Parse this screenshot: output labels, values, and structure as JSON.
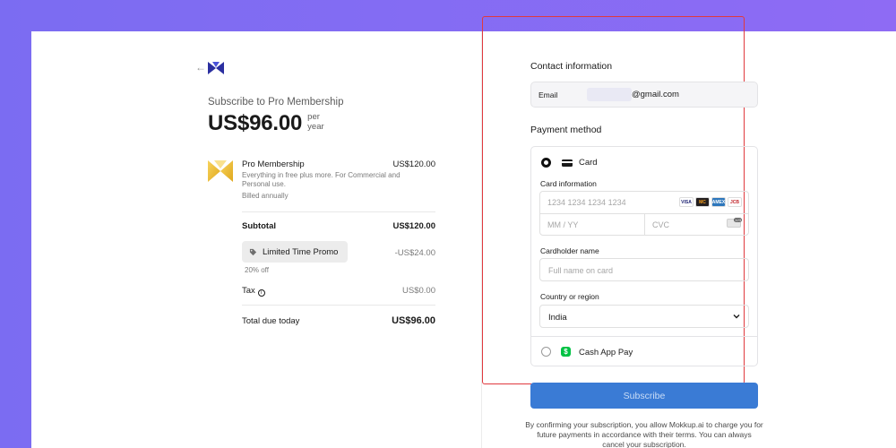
{
  "summary": {
    "back_icon": "arrow-left-icon",
    "logo_icon": "mokkup-logo-icon",
    "subscribe_title": "Subscribe to Pro Membership",
    "price": "US$96.00",
    "per_line1": "per",
    "per_line2": "year",
    "product": {
      "name": "Pro Membership",
      "price": "US$120.00",
      "description": "Everything in free plus more. For Commercial and Personal use.",
      "billing": "Billed annually",
      "icon": "gold-m-logo-icon"
    },
    "subtotal_label": "Subtotal",
    "subtotal_value": "US$120.00",
    "promo_label": "Limited Time Promo",
    "promo_value": "-US$24.00",
    "promo_discount": "20% off",
    "tax_label": "Tax",
    "tax_value": "US$0.00",
    "total_label": "Total due today",
    "total_value": "US$96.00"
  },
  "contact": {
    "title": "Contact information",
    "email_label": "Email",
    "email_value": "@gmail.com"
  },
  "payment": {
    "title": "Payment method",
    "card_option": "Card",
    "card_info_label": "Card information",
    "card_number_placeholder": "1234 1234 1234 1234",
    "expiry_placeholder": "MM / YY",
    "cvc_placeholder": "CVC",
    "card_brands": [
      "VISA",
      "MC",
      "AMEX",
      "JCB"
    ],
    "cardholder_label": "Cardholder name",
    "cardholder_placeholder": "Full name on card",
    "country_label": "Country or region",
    "country_value": "India",
    "cashapp_option": "Cash App Pay"
  },
  "actions": {
    "subscribe_label": "Subscribe"
  },
  "legal_text": "By confirming your subscription, you allow Mokkup.ai to charge you for future payments in accordance with their terms. You can always cancel your subscription.",
  "colors": {
    "background_gradient": [
      "#7b6cf2",
      "#8e6bf4"
    ],
    "primary_button": "#3a7bd5",
    "highlight_border": "#e0393e",
    "brand_navy": "#2b2fa0",
    "cashapp_green": "#00c244"
  }
}
